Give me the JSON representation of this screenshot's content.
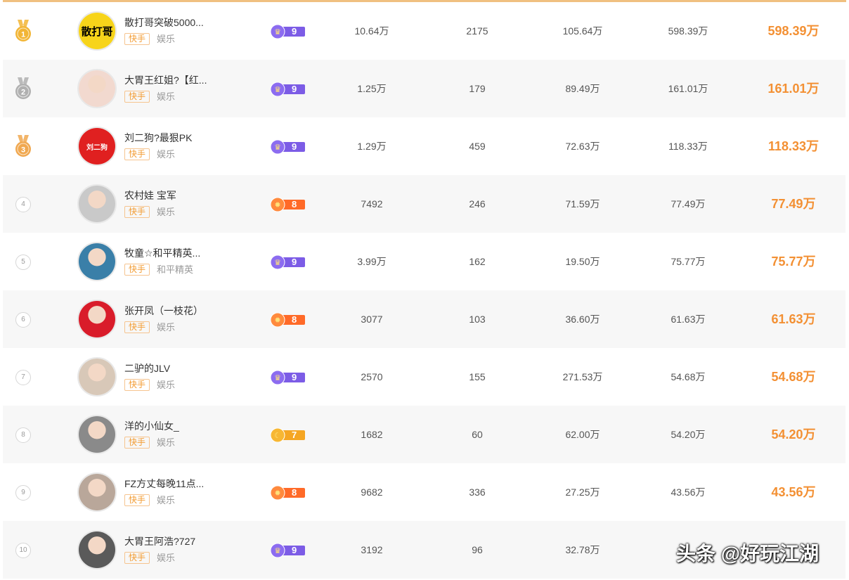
{
  "colors": {
    "accent": "#f39033",
    "badge_purple": "#7c5ce6",
    "badge_orange": "#ff6a28",
    "badge_yellow": "#f5a623",
    "gold": "#f2b535",
    "silver": "#b0b0b0",
    "bronze": "#f0a850"
  },
  "rows": [
    {
      "rank": "1",
      "name": "散打哥突破5000...",
      "platform": "快手",
      "category": "娱乐",
      "level": "9",
      "level_icon": "crown-icon",
      "v1": "10.64万",
      "v2": "2175",
      "v3": "105.64万",
      "v4": "598.39万",
      "total": "598.39万",
      "avatar_text": "散打哥",
      "avatar_color": "#f7d41a"
    },
    {
      "rank": "2",
      "name": "大胃王红姐?【红...",
      "platform": "快手",
      "category": "娱乐",
      "level": "9",
      "level_icon": "crown-icon",
      "v1": "1.25万",
      "v2": "179",
      "v3": "89.49万",
      "v4": "161.01万",
      "total": "161.01万",
      "avatar_text": "",
      "avatar_color": "#f2d9cf"
    },
    {
      "rank": "3",
      "name": "刘二狗?最狠PK",
      "platform": "快手",
      "category": "娱乐",
      "level": "9",
      "level_icon": "crown-icon",
      "v1": "1.29万",
      "v2": "459",
      "v3": "72.63万",
      "v4": "118.33万",
      "total": "118.33万",
      "avatar_text": "刘二狗",
      "avatar_color": "#e02020"
    },
    {
      "rank": "4",
      "name": "农村娃 宝军",
      "platform": "快手",
      "category": "娱乐",
      "level": "8",
      "level_icon": "sun-icon",
      "v1": "7492",
      "v2": "246",
      "v3": "71.59万",
      "v4": "77.49万",
      "total": "77.49万",
      "avatar_text": "",
      "avatar_color": "#c9c9c9"
    },
    {
      "rank": "5",
      "name": "牧童☆和平精英...",
      "platform": "快手",
      "category": "和平精英",
      "level": "9",
      "level_icon": "crown-icon",
      "v1": "3.99万",
      "v2": "162",
      "v3": "19.50万",
      "v4": "75.77万",
      "total": "75.77万",
      "avatar_text": "",
      "avatar_color": "#3a7fa8"
    },
    {
      "rank": "6",
      "name": "张开凤（一枝花）",
      "platform": "快手",
      "category": "娱乐",
      "level": "8",
      "level_icon": "sun-icon",
      "v1": "3077",
      "v2": "103",
      "v3": "36.60万",
      "v4": "61.63万",
      "total": "61.63万",
      "avatar_text": "",
      "avatar_color": "#d91c2a"
    },
    {
      "rank": "7",
      "name": "二驴的JLV",
      "platform": "快手",
      "category": "娱乐",
      "level": "9",
      "level_icon": "crown-icon",
      "v1": "2570",
      "v2": "155",
      "v3": "271.53万",
      "v4": "54.68万",
      "total": "54.68万",
      "avatar_text": "",
      "avatar_color": "#d8c8b8"
    },
    {
      "rank": "8",
      "name": "洋的小仙女_",
      "platform": "快手",
      "category": "娱乐",
      "level": "7",
      "level_icon": "moon-icon",
      "v1": "1682",
      "v2": "60",
      "v3": "62.00万",
      "v4": "54.20万",
      "total": "54.20万",
      "avatar_text": "",
      "avatar_color": "#8a8a8a"
    },
    {
      "rank": "9",
      "name": "FZ方丈每晚11点...",
      "platform": "快手",
      "category": "娱乐",
      "level": "8",
      "level_icon": "sun-icon",
      "v1": "9682",
      "v2": "336",
      "v3": "27.25万",
      "v4": "43.56万",
      "total": "43.56万",
      "avatar_text": "",
      "avatar_color": "#b9a79a"
    },
    {
      "rank": "10",
      "name": "大胃王阿浩?727",
      "platform": "快手",
      "category": "娱乐",
      "level": "9",
      "level_icon": "crown-icon",
      "v1": "3192",
      "v2": "96",
      "v3": "32.78万",
      "v4": "3...",
      "total": "",
      "avatar_text": "",
      "avatar_color": "#5a5a5a"
    }
  ],
  "watermark": "头条 @好玩江湖"
}
